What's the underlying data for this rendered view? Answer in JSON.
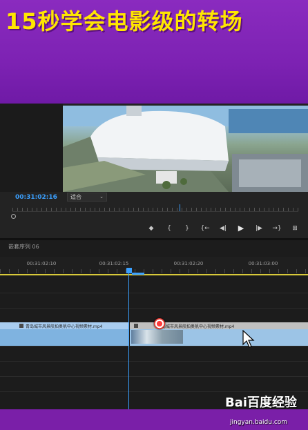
{
  "banner": {
    "title": "15秒学会电影级的转场"
  },
  "monitor": {
    "timecode": "00:31:02:16",
    "fit_label": "适合"
  },
  "transport": {
    "buttons": [
      "marker",
      "mark-in",
      "mark-out",
      "go-to-in",
      "step-back",
      "play",
      "step-forward",
      "go-to-out",
      "lift"
    ]
  },
  "timeline": {
    "sequence_name": "嵌套序列 06",
    "ruler_ticks": [
      "00:31:02:10",
      "00:31:02:15",
      "00:31:02:20",
      "00:31:03:00"
    ],
    "clips": [
      {
        "label": "青岛城市风景航拍奥帆中心视频素材.mp4"
      },
      {
        "label": "青岛城市风景航拍奥帆中心视频素材.mp4"
      }
    ]
  },
  "watermark": {
    "logo": "Bai百度经验",
    "url": "jingyan.baidu.com"
  },
  "colors": {
    "accent": "#3aa0ff",
    "banner_bg": "#7a1fa8",
    "banner_text": "#ffe600"
  }
}
